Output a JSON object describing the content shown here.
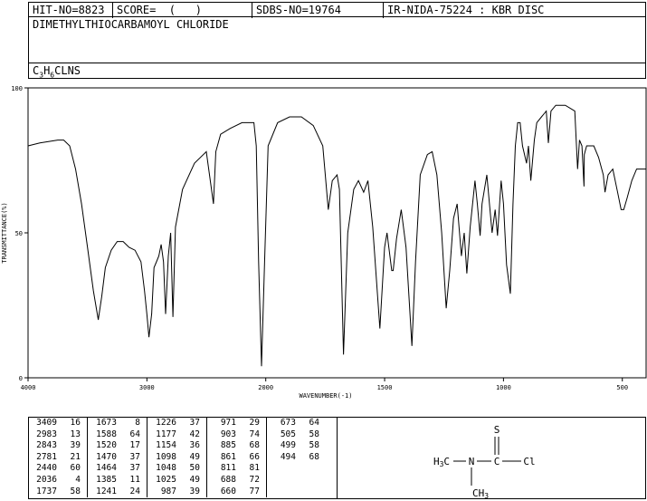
{
  "header": {
    "hit_no": "HIT-NO=8823",
    "score": "SCORE=  (   )",
    "sdbs_no": "SDBS-NO=19764",
    "ir_info": "IR-NIDA-75224 : KBR DISC"
  },
  "compound_name": "DIMETHYLTHIOCARBAMOYL CHLORIDE",
  "formula": {
    "c": "C",
    "c_n": "3",
    "h": "H",
    "h_n": "6",
    "rest": "CLNS"
  },
  "chart_data": {
    "type": "line",
    "xlabel": "WAVENUMBER(-1)",
    "ylabel": "TRANSMITTANCE(%)",
    "xlim": [
      4000,
      400
    ],
    "ylim": [
      0,
      100
    ],
    "x_ticks": [
      4000,
      3000,
      2000,
      1500,
      1000,
      500
    ],
    "y_ticks": [
      0,
      50,
      100
    ],
    "series": [
      {
        "points": [
          [
            4000,
            80
          ],
          [
            3900,
            81
          ],
          [
            3750,
            82
          ],
          [
            3700,
            82
          ],
          [
            3650,
            80
          ],
          [
            3600,
            72
          ],
          [
            3550,
            60
          ],
          [
            3500,
            45
          ],
          [
            3450,
            30
          ],
          [
            3409,
            20
          ],
          [
            3380,
            28
          ],
          [
            3350,
            38
          ],
          [
            3300,
            44
          ],
          [
            3250,
            47
          ],
          [
            3200,
            47
          ],
          [
            3150,
            45
          ],
          [
            3100,
            44
          ],
          [
            3050,
            40
          ],
          [
            3020,
            30
          ],
          [
            3000,
            22
          ],
          [
            2983,
            14
          ],
          [
            2960,
            22
          ],
          [
            2940,
            38
          ],
          [
            2920,
            40
          ],
          [
            2900,
            42
          ],
          [
            2880,
            46
          ],
          [
            2860,
            40
          ],
          [
            2843,
            22
          ],
          [
            2820,
            42
          ],
          [
            2800,
            50
          ],
          [
            2781,
            21
          ],
          [
            2760,
            52
          ],
          [
            2700,
            65
          ],
          [
            2600,
            74
          ],
          [
            2500,
            78
          ],
          [
            2440,
            60
          ],
          [
            2420,
            78
          ],
          [
            2380,
            84
          ],
          [
            2300,
            86
          ],
          [
            2200,
            88
          ],
          [
            2100,
            88
          ],
          [
            2080,
            80
          ],
          [
            2060,
            40
          ],
          [
            2036,
            4
          ],
          [
            2010,
            40
          ],
          [
            1990,
            80
          ],
          [
            1950,
            88
          ],
          [
            1900,
            90
          ],
          [
            1850,
            90
          ],
          [
            1800,
            87
          ],
          [
            1760,
            80
          ],
          [
            1737,
            58
          ],
          [
            1720,
            68
          ],
          [
            1700,
            70
          ],
          [
            1690,
            65
          ],
          [
            1673,
            8
          ],
          [
            1655,
            50
          ],
          [
            1630,
            65
          ],
          [
            1610,
            68
          ],
          [
            1588,
            64
          ],
          [
            1570,
            68
          ],
          [
            1550,
            52
          ],
          [
            1520,
            17
          ],
          [
            1500,
            45
          ],
          [
            1490,
            50
          ],
          [
            1470,
            37
          ],
          [
            1464,
            37
          ],
          [
            1450,
            48
          ],
          [
            1430,
            58
          ],
          [
            1410,
            45
          ],
          [
            1385,
            11
          ],
          [
            1370,
            40
          ],
          [
            1350,
            70
          ],
          [
            1320,
            77
          ],
          [
            1300,
            78
          ],
          [
            1280,
            70
          ],
          [
            1260,
            50
          ],
          [
            1241,
            24
          ],
          [
            1226,
            37
          ],
          [
            1210,
            55
          ],
          [
            1195,
            60
          ],
          [
            1177,
            42
          ],
          [
            1165,
            50
          ],
          [
            1154,
            36
          ],
          [
            1140,
            52
          ],
          [
            1120,
            68
          ],
          [
            1110,
            60
          ],
          [
            1098,
            49
          ],
          [
            1090,
            60
          ],
          [
            1070,
            70
          ],
          [
            1048,
            50
          ],
          [
            1035,
            58
          ],
          [
            1025,
            49
          ],
          [
            1010,
            68
          ],
          [
            1000,
            60
          ],
          [
            987,
            39
          ],
          [
            971,
            29
          ],
          [
            960,
            60
          ],
          [
            950,
            80
          ],
          [
            940,
            88
          ],
          [
            930,
            88
          ],
          [
            920,
            80
          ],
          [
            903,
            74
          ],
          [
            895,
            80
          ],
          [
            885,
            68
          ],
          [
            870,
            82
          ],
          [
            860,
            88
          ],
          [
            840,
            90
          ],
          [
            820,
            92
          ],
          [
            811,
            81
          ],
          [
            800,
            92
          ],
          [
            780,
            94
          ],
          [
            740,
            94
          ],
          [
            700,
            92
          ],
          [
            688,
            72
          ],
          [
            680,
            82
          ],
          [
            670,
            80
          ],
          [
            661,
            66
          ],
          [
            660,
            77
          ],
          [
            650,
            80
          ],
          [
            620,
            80
          ],
          [
            600,
            76
          ],
          [
            580,
            70
          ],
          [
            573,
            64
          ],
          [
            560,
            70
          ],
          [
            540,
            72
          ],
          [
            520,
            64
          ],
          [
            505,
            58
          ],
          [
            499,
            58
          ],
          [
            494,
            58
          ],
          [
            480,
            62
          ],
          [
            460,
            68
          ],
          [
            440,
            72
          ],
          [
            420,
            72
          ],
          [
            400,
            72
          ]
        ]
      }
    ]
  },
  "peak_table": {
    "columns": [
      [
        [
          "3409",
          "16"
        ],
        [
          "2983",
          "13"
        ],
        [
          "2843",
          "39"
        ],
        [
          "2781",
          "21"
        ],
        [
          "2440",
          "60"
        ],
        [
          "2036",
          "4"
        ],
        [
          "1737",
          "58"
        ]
      ],
      [
        [
          "1673",
          "8"
        ],
        [
          "1588",
          "64"
        ],
        [
          "1520",
          "17"
        ],
        [
          "1470",
          "37"
        ],
        [
          "1464",
          "37"
        ],
        [
          "1385",
          "11"
        ],
        [
          "1241",
          "24"
        ]
      ],
      [
        [
          "1226",
          "37"
        ],
        [
          "1177",
          "42"
        ],
        [
          "1154",
          "36"
        ],
        [
          "1098",
          "49"
        ],
        [
          "1048",
          "50"
        ],
        [
          "1025",
          "49"
        ],
        [
          "987",
          "39"
        ]
      ],
      [
        [
          "971",
          "29"
        ],
        [
          "903",
          "74"
        ],
        [
          "885",
          "68"
        ],
        [
          "861",
          "66"
        ],
        [
          "811",
          "81"
        ],
        [
          "688",
          "72"
        ],
        [
          "660",
          "77"
        ]
      ],
      [
        [
          "673",
          "64"
        ],
        [
          "505",
          "58"
        ],
        [
          "499",
          "58"
        ],
        [
          "494",
          "68"
        ]
      ]
    ]
  },
  "structure": {
    "s": "S",
    "left": "H3C",
    "n": "N",
    "c": "C",
    "cl": "Cl",
    "bottom": "CH3"
  }
}
